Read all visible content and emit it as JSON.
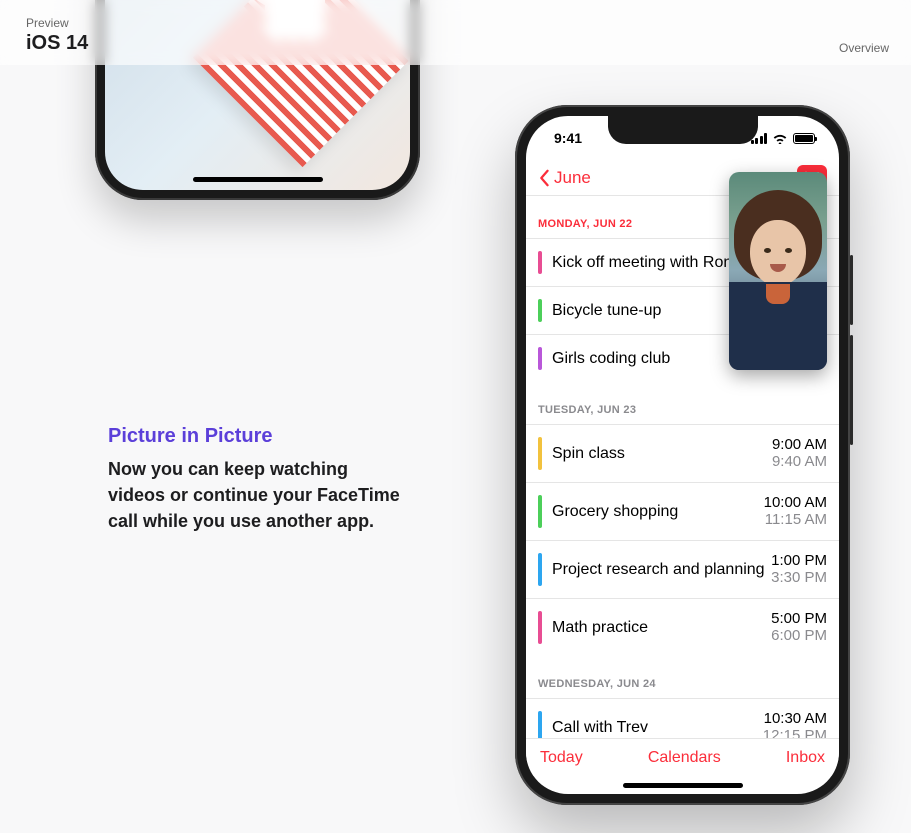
{
  "topbar": {
    "preview": "Preview",
    "title": "iOS 14",
    "overview": "Overview"
  },
  "feature": {
    "heading": "Picture in Picture",
    "body": "Now you can keep watching videos or continue your FaceTime call while you use another app."
  },
  "phone": {
    "status": {
      "time": "9:41"
    },
    "nav": {
      "back": "June"
    },
    "sections": [
      {
        "label": "MONDAY, JUN 22",
        "emphasis": "red",
        "events": [
          {
            "title": "Kick off meeting with Ron",
            "color": "#e84d93",
            "start": "",
            "end": ""
          },
          {
            "title": "Bicycle tune-up",
            "color": "#4ccf5a",
            "start": "",
            "end": ""
          },
          {
            "title": "Girls coding club",
            "color": "#b957d9",
            "start": "",
            "end": ""
          }
        ]
      },
      {
        "label": "TUESDAY, JUN 23",
        "emphasis": "gray",
        "events": [
          {
            "title": "Spin class",
            "color": "#f2c23e",
            "start": "9:00 AM",
            "end": "9:40 AM"
          },
          {
            "title": "Grocery shopping",
            "color": "#4ccf5a",
            "start": "10:00 AM",
            "end": "11:15 AM"
          },
          {
            "title": "Project research and planning",
            "color": "#2da6f0",
            "start": "1:00 PM",
            "end": "3:30 PM"
          },
          {
            "title": "Math practice",
            "color": "#e84d93",
            "start": "5:00 PM",
            "end": "6:00 PM"
          }
        ]
      },
      {
        "label": "WEDNESDAY, JUN 24",
        "emphasis": "gray",
        "events": [
          {
            "title": "Call with Trev",
            "color": "#2da6f0",
            "start": "10:30 AM",
            "end": "12:15 PM"
          }
        ]
      }
    ],
    "toolbar": {
      "today": "Today",
      "calendars": "Calendars",
      "inbox": "Inbox"
    }
  }
}
